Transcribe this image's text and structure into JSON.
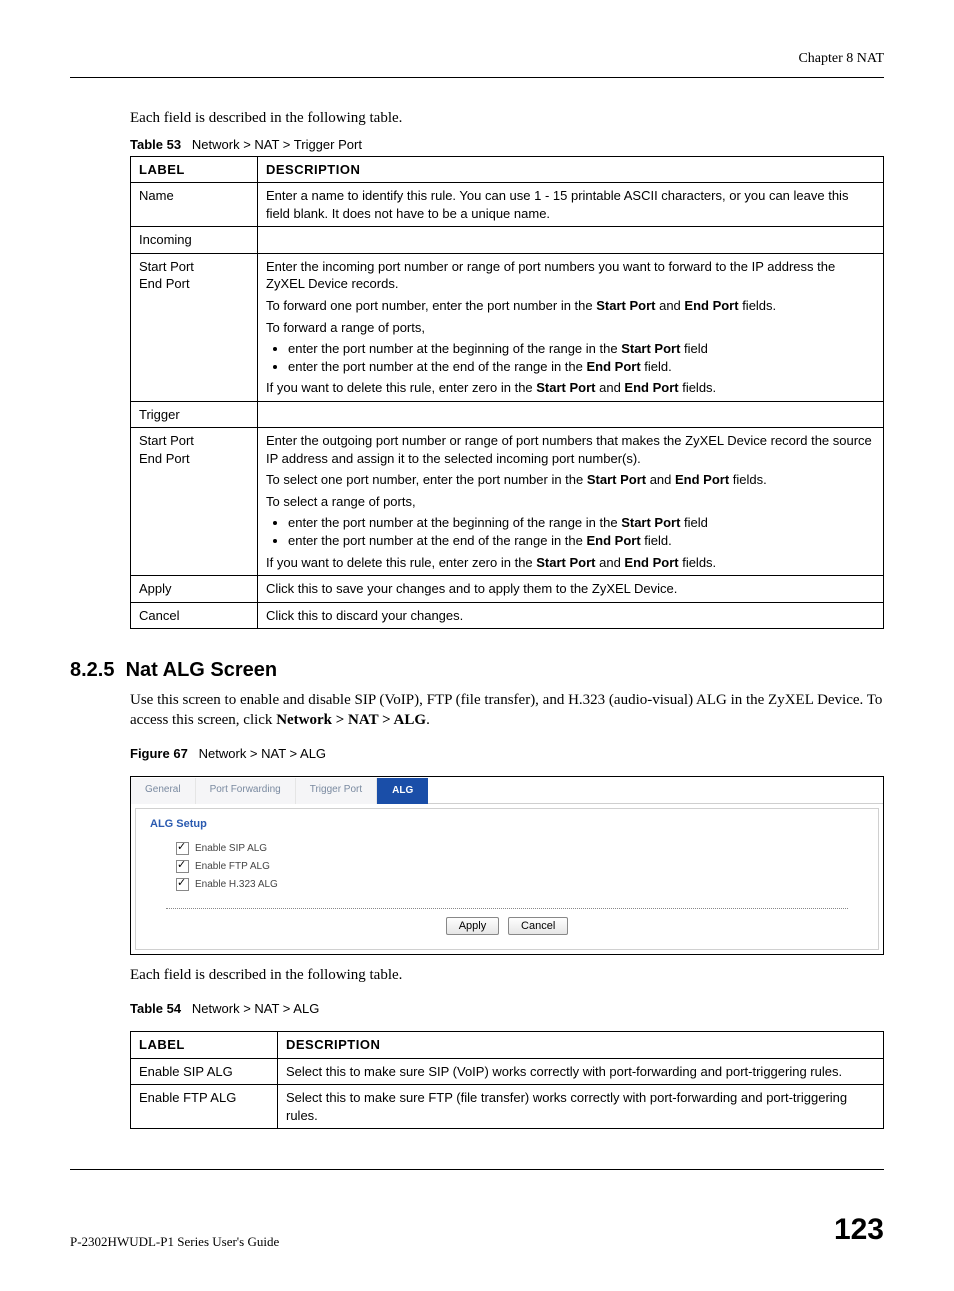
{
  "chapter_header": "Chapter 8 NAT",
  "intro1": "Each field is described in the following table.",
  "table53": {
    "caption_prefix": "Table 53",
    "caption_text": "Network > NAT > Trigger Port",
    "head_label": "LABEL",
    "head_desc": "DESCRIPTION",
    "rows": {
      "name_label": "Name",
      "name_desc": "Enter a name to identify this rule. You can use 1 - 15 printable ASCII characters, or you can leave this field blank. It does not have to be a unique name.",
      "incoming_label": "Incoming",
      "incoming_desc": "",
      "startend1_label1": "Start Port",
      "startend1_label2": "End Port",
      "se1_p1a": "Enter the incoming port number or range of port numbers you want to forward to the IP address the ZyXEL Device records.",
      "se1_p2a": "To forward one port number, enter the port number in the ",
      "se1_p2b": "Start Port",
      "se1_p2c": " and ",
      "se1_p2d": "End Port",
      "se1_p2e": " fields.",
      "se1_p3": "To forward a range of ports,",
      "se1_li1a": "enter the port number at the beginning of the range in the ",
      "se1_li1b": "Start Port",
      "se1_li1c": " field",
      "se1_li2a": "enter the port number at the end of the range in the ",
      "se1_li2b": "End Port",
      "se1_li2c": " field.",
      "se1_p4a": "If you want to delete this rule, enter zero in the ",
      "se1_p4b": "Start Port",
      "se1_p4c": " and ",
      "se1_p4d": "End Port",
      "se1_p4e": " fields.",
      "trigger_label": "Trigger",
      "trigger_desc": "",
      "startend2_label1": "Start Port",
      "startend2_label2": "End Port",
      "se2_p1": "Enter the outgoing port number or range of port numbers that makes the ZyXEL Device record the source IP address and assign it to the selected incoming port number(s).",
      "se2_p2a": "To select one port number, enter the port number in the ",
      "se2_p2b": "Start Port",
      "se2_p2c": " and ",
      "se2_p2d": "End Port",
      "se2_p2e": " fields.",
      "se2_p3": "To select a range of ports,",
      "se2_li1a": "enter the port number at the beginning of the range in the ",
      "se2_li1b": "Start Port",
      "se2_li1c": " field",
      "se2_li2a": "enter the port number at the end of the range in the ",
      "se2_li2b": "End Port",
      "se2_li2c": " field.",
      "se2_p4a": "If you want to delete this rule, enter zero in the ",
      "se2_p4b": "Start Port",
      "se2_p4c": " and ",
      "se2_p4d": "End Port",
      "se2_p4e": " fields.",
      "apply_label": "Apply",
      "apply_desc": "Click this to save your changes and to apply them to the ZyXEL Device.",
      "cancel_label": "Cancel",
      "cancel_desc": "Click this to discard your changes."
    }
  },
  "section": {
    "number": "8.2.5",
    "title": "Nat ALG Screen",
    "p1a": "Use this screen to enable and disable SIP (VoIP), FTP (file transfer), and H.323 (audio-visual) ALG in the ZyXEL Device. To access this screen, click ",
    "p1b": "Network > NAT > ALG",
    "p1c": "."
  },
  "figure67": {
    "caption_prefix": "Figure 67",
    "caption_text": "Network > NAT > ALG",
    "tabs": {
      "t1": "General",
      "t2": "Port Forwarding",
      "t3": "Trigger Port",
      "t4": "ALG"
    },
    "panel_title": "ALG Setup",
    "opt1": "Enable SIP ALG",
    "opt2": "Enable FTP ALG",
    "opt3": "Enable H.323 ALG",
    "btn_apply": "Apply",
    "btn_cancel": "Cancel"
  },
  "intro2": "Each field is described in the following table.",
  "table54": {
    "caption_prefix": "Table 54",
    "caption_text": "Network > NAT > ALG",
    "head_label": "LABEL",
    "head_desc": "DESCRIPTION",
    "r1_label": "Enable SIP ALG",
    "r1_desc": "Select this to make sure SIP (VoIP) works correctly with port-forwarding and port-triggering rules.",
    "r2_label": "Enable FTP ALG",
    "r2_desc": "Select this to make sure FTP (file transfer) works correctly with port-forwarding and port-triggering rules."
  },
  "footer": {
    "left": "P-2302HWUDL-P1 Series User's Guide",
    "right": "123"
  }
}
